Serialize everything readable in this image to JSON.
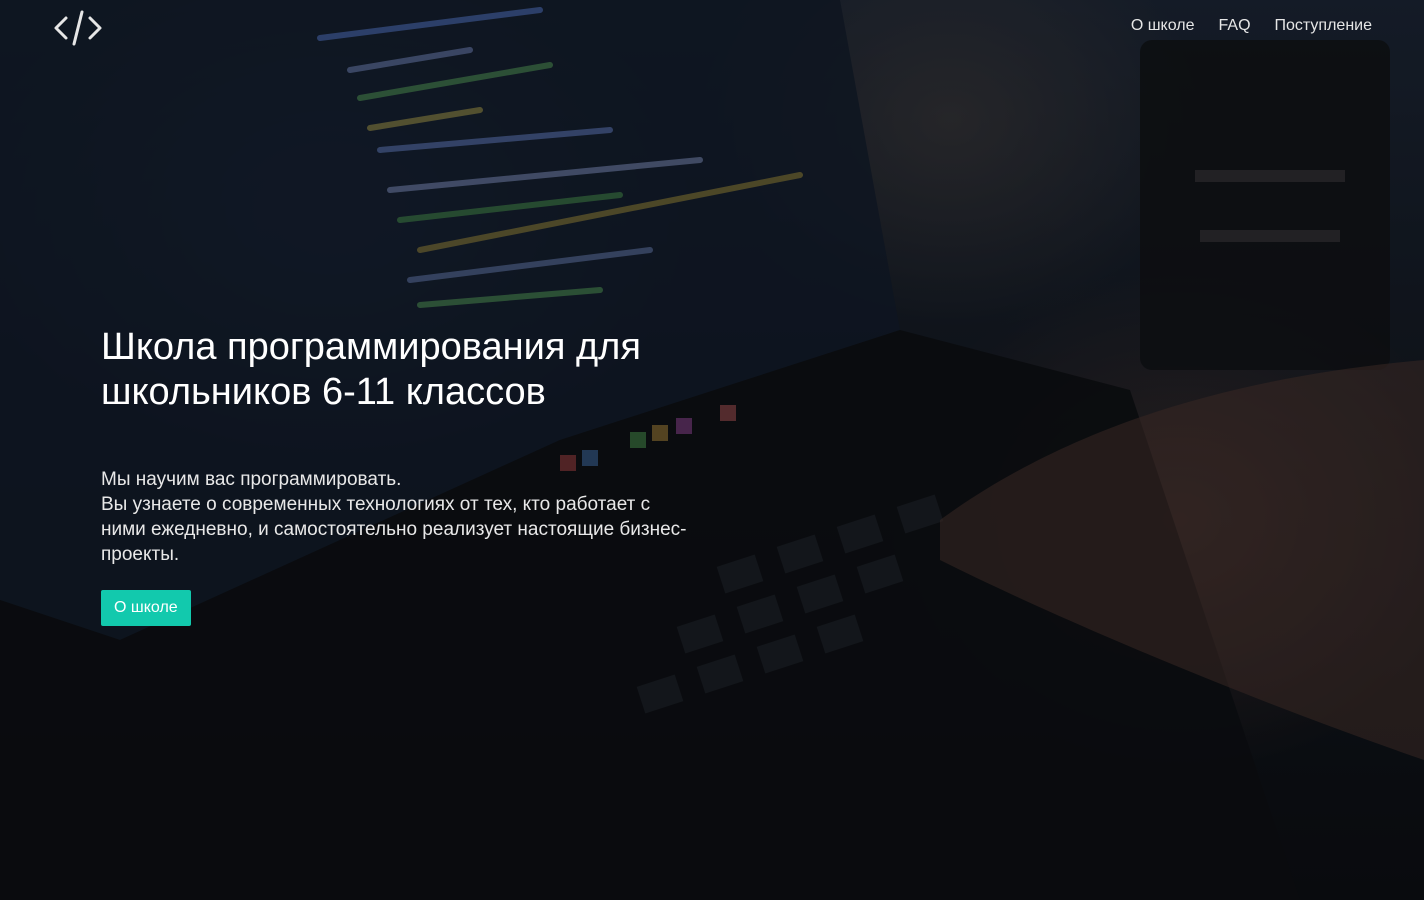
{
  "brand": {
    "logo_icon": "code-brackets-icon",
    "logo_color": "#e6e6e6"
  },
  "nav": {
    "items": [
      {
        "label": "О школе"
      },
      {
        "label": "FAQ"
      },
      {
        "label": "Поступление"
      }
    ]
  },
  "hero": {
    "title": "Школа программирования для школьников 6-11 классов",
    "text_line1": "Мы научим вас программировать.",
    "text_line2": "Вы узнаете о современных технологиях от тех, кто работает с ними ежедневно, и самостоятельно реализует настоящие бизнес-проекты.",
    "cta_label": "О школе",
    "cta_color": "#12c9ad",
    "background_image": "laptop-with-code-photo"
  }
}
